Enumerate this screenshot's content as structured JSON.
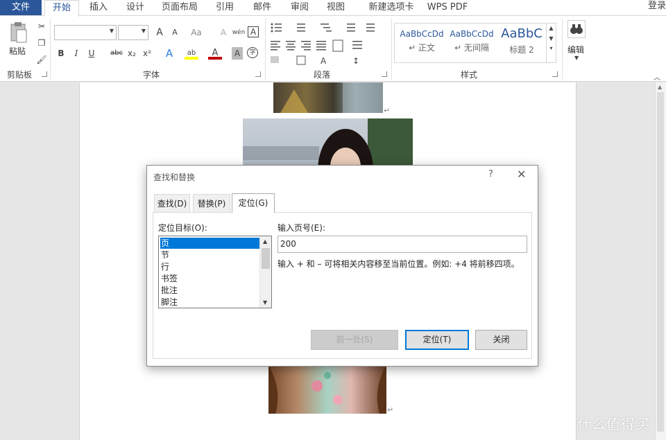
{
  "ribbon_tabs": {
    "file": "文件",
    "items": [
      "开始",
      "插入",
      "设计",
      "页面布局",
      "引用",
      "邮件",
      "审阅",
      "视图",
      "新建选项卡",
      "WPS PDF"
    ],
    "active_index": 0,
    "login": "登录"
  },
  "clipboard": {
    "paste_label": "粘贴",
    "group_label": "剪贴板"
  },
  "font_group": {
    "group_label": "字体",
    "font_name": "",
    "font_size": "",
    "grow_icon": "A",
    "shrink_icon": "A",
    "case_icon": "Aa",
    "clear_format_icon": "A",
    "phonetic_icon": "wén",
    "border_char_icon": "A",
    "bold": "B",
    "italic": "I",
    "underline": "U",
    "strike": "abc",
    "subscript": "x₂",
    "superscript": "x²",
    "text_effect": "A",
    "highlight": "ab",
    "font_color": "A",
    "char_shading": "A",
    "enclose": "字"
  },
  "paragraph_group": {
    "group_label": "段落"
  },
  "styles_group": {
    "group_label": "样式",
    "items": [
      {
        "sample": "AaBbCcDd",
        "name": "↵ 正文"
      },
      {
        "sample": "AaBbCcDd",
        "name": "↵ 无间隔"
      },
      {
        "sample": "AaBbC",
        "name": "标题 2"
      }
    ]
  },
  "editing_group": {
    "label": "编辑"
  },
  "document": {
    "para_marks": [
      "↵",
      "↵"
    ]
  },
  "dialog": {
    "title": "查找和替换",
    "help": "?",
    "close": "✕",
    "tabs": [
      "查找(D)",
      "替换(P)",
      "定位(G)"
    ],
    "active_tab": 2,
    "target_label": "定位目标(O):",
    "targets": [
      "页",
      "节",
      "行",
      "书签",
      "批注",
      "脚注"
    ],
    "selected_target": 0,
    "page_label": "输入页号(E):",
    "page_value": "200",
    "hint": "输入 + 和 – 可将相关内容移至当前位置。例如: +4 将前移四项。",
    "buttons": {
      "previous": "前一处(S)",
      "goto": "定位(T)",
      "close": "关闭"
    }
  },
  "watermark": {
    "text": "什么值得买"
  },
  "colors": {
    "accent": "#2b579a",
    "selection": "#0078d7"
  }
}
